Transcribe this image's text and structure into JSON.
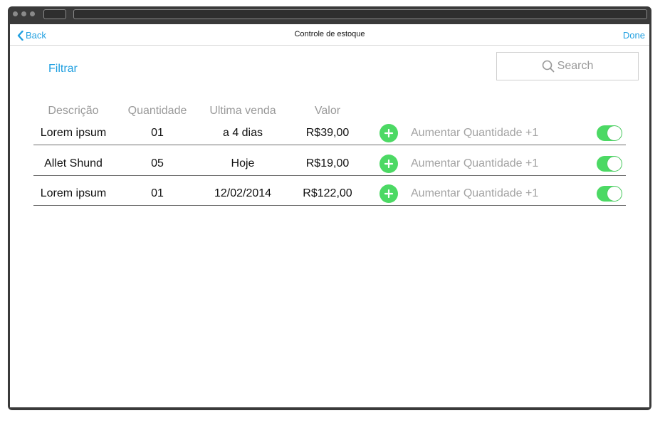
{
  "navbar": {
    "back_label": "Back",
    "title": "Controle de estoque",
    "done_label": "Done"
  },
  "toolbar": {
    "filter_label": "Filtrar",
    "search_placeholder": "Search"
  },
  "table": {
    "headers": [
      "Descrição",
      "Quantidade",
      "Ultima venda",
      "Valor"
    ],
    "rows": [
      {
        "descricao": "Lorem ipsum",
        "quantidade": "01",
        "ultima_venda": "a 4 dias",
        "valor": "R$39,00",
        "action_label": "Aumentar Quantidade +1",
        "toggle_on": true
      },
      {
        "descricao": "Allet Shund",
        "quantidade": "05",
        "ultima_venda": "Hoje",
        "valor": "R$19,00",
        "action_label": "Aumentar Quantidade +1",
        "toggle_on": true
      },
      {
        "descricao": "Lorem ipsum",
        "quantidade": "01",
        "ultima_venda": "12/02/2014",
        "valor": "R$122,00",
        "action_label": "Aumentar Quantidade +1",
        "toggle_on": true
      }
    ]
  },
  "colors": {
    "accent": "#1f9fe0",
    "add_button": "#4cd964",
    "toggle_on": "#4cd964",
    "frame": "#3a3a3a"
  },
  "icons": {
    "back": "chevron-left-icon",
    "search": "search-icon",
    "add": "plus-circle-icon"
  }
}
